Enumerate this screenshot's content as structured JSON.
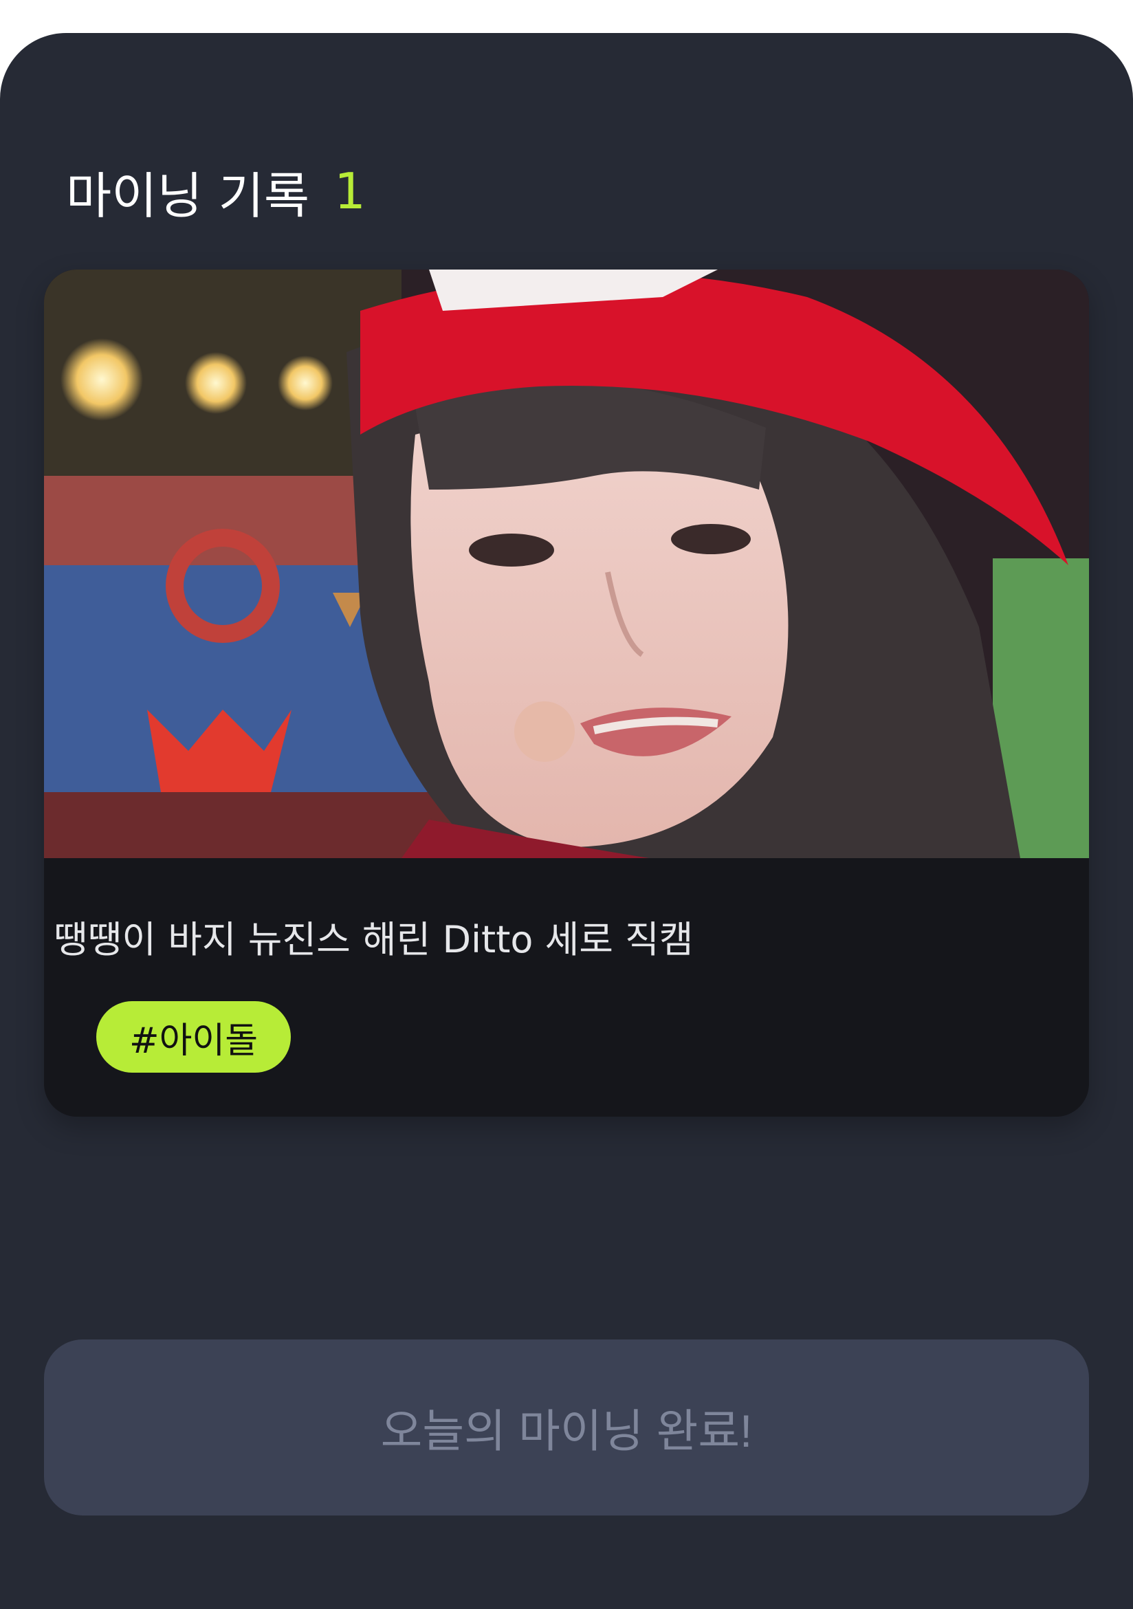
{
  "header": {
    "title": "마이닝 기록",
    "count": "1"
  },
  "card": {
    "thumbnail_description_icon": "video-thumbnail",
    "title": "땡땡이 바지 뉴진스 해린 Ditto 세로 직캠",
    "tag": "#아이돌"
  },
  "complete_button": {
    "label": "오늘의 마이닝 완료!"
  },
  "colors": {
    "background": "#262a35",
    "accent": "#b7ec37",
    "card": "#15161b",
    "button_disabled": "#3c4255",
    "button_text_disabled": "#7f869b"
  }
}
